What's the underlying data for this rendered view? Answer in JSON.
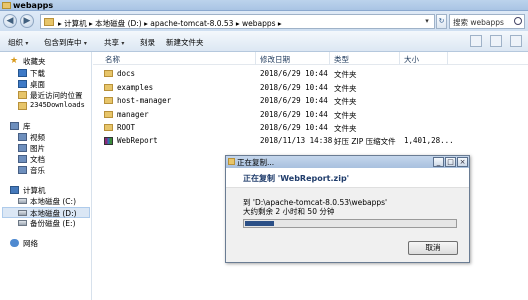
{
  "window": {
    "title": "webapps"
  },
  "address": {
    "crumbs": "▸ 计算机 ▸ 本地磁盘 (D:) ▸ apache-tomcat-8.0.53 ▸ webapps ▸",
    "search_placeholder": "搜索 webapps"
  },
  "toolbar": {
    "organize": "组织",
    "include": "包含到库中",
    "share": "共享",
    "burn": "刻录",
    "new_folder": "新建文件夹"
  },
  "nav": {
    "favorites": "收藏夹",
    "downloads": "下载",
    "desktop": "桌面",
    "recent": "最近访问的位置",
    "d2345": "2345Downloads",
    "libraries": "库",
    "videos": "视频",
    "pictures": "图片",
    "documents": "文档",
    "music": "音乐",
    "computer": "计算机",
    "drive_c": "本地磁盘 (C:)",
    "drive_d": "本地磁盘 (D:)",
    "drive_e": "备份磁盘 (E:)",
    "network": "网络"
  },
  "columns": {
    "name": "名称",
    "date": "修改日期",
    "type": "类型",
    "size": "大小"
  },
  "files": [
    {
      "name": "docs",
      "date": "2018/6/29 10:44",
      "type": "文件夹",
      "size": ""
    },
    {
      "name": "examples",
      "date": "2018/6/29 10:44",
      "type": "文件夹",
      "size": ""
    },
    {
      "name": "host-manager",
      "date": "2018/6/29 10:44",
      "type": "文件夹",
      "size": ""
    },
    {
      "name": "manager",
      "date": "2018/6/29 10:44",
      "type": "文件夹",
      "size": ""
    },
    {
      "name": "ROOT",
      "date": "2018/6/29 10:44",
      "type": "文件夹",
      "size": ""
    },
    {
      "name": "WebReport",
      "date": "2018/11/13 14:38",
      "type": "好压 ZIP 压缩文件",
      "size": "1,401,28..."
    }
  ],
  "dialog": {
    "title": "正在复制...",
    "header": "正在复制 'WebReport.zip'",
    "dest": "到 'D:\\apache-tomcat-8.0.53\\webapps'",
    "remaining": "大约剩余 2 小时和 50 分钟",
    "progress": 0.14,
    "cancel": "取消",
    "min_glyph": "_",
    "max_glyph": "□",
    "close_glyph": "×"
  }
}
